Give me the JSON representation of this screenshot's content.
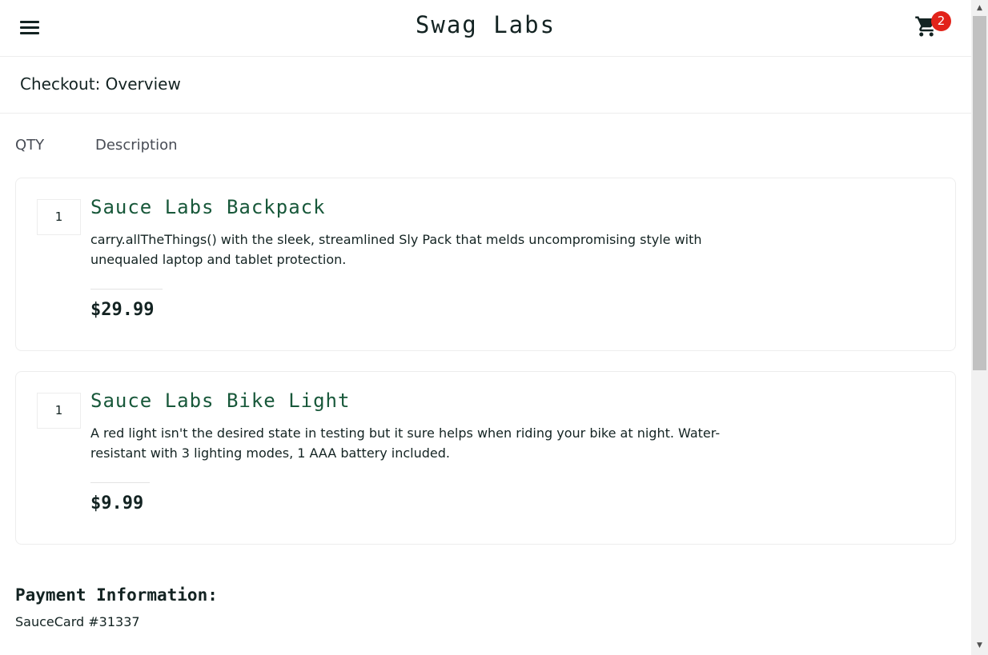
{
  "header": {
    "title": "Swag Labs",
    "menu_icon": "hamburger-icon",
    "cart_icon": "shopping-cart-icon",
    "cart_count": "2"
  },
  "page": {
    "title": "Checkout: Overview"
  },
  "columns": {
    "qty": "QTY",
    "description": "Description"
  },
  "items": [
    {
      "qty": "1",
      "name": "Sauce Labs Backpack",
      "description": "carry.allTheThings() with the sleek, streamlined Sly Pack that melds uncompromising style with unequaled laptop and tablet protection.",
      "price": "$29.99"
    },
    {
      "qty": "1",
      "name": "Sauce Labs Bike Light",
      "description": "A red light isn't the desired state in testing but it sure helps when riding your bike at night. Water-resistant with 3 lighting modes, 1 AAA battery included.",
      "price": "$9.99"
    }
  ],
  "summary": {
    "payment_label": "Payment Information:",
    "payment_value": "SauceCard #31337"
  },
  "colors": {
    "accent_green": "#18583a",
    "badge_red": "#e2231a",
    "text_dark": "#132322"
  }
}
